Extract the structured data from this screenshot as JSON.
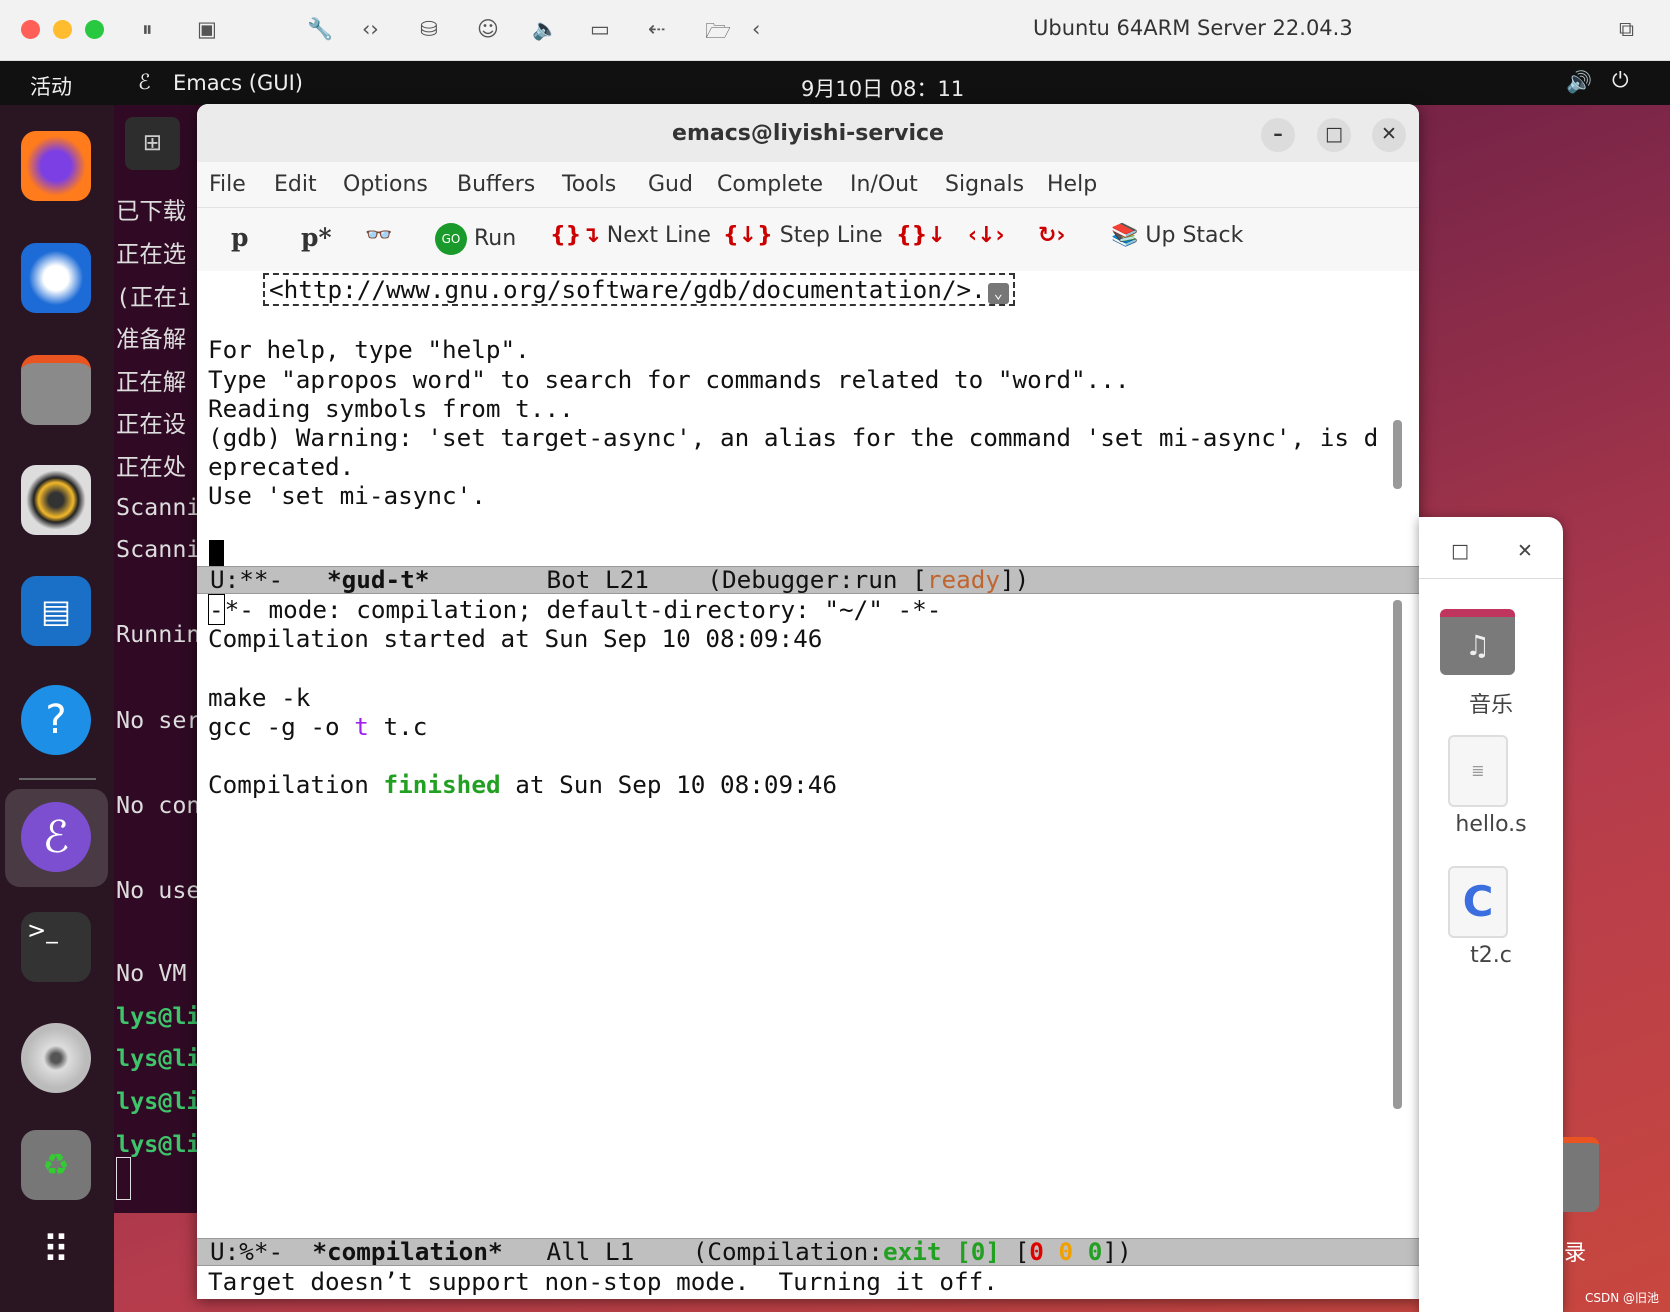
{
  "mac": {
    "title": "Ubuntu 64ARM Server 22.04.3"
  },
  "topbar": {
    "activities": "活动",
    "app": "Emacs (GUI)",
    "clock": "9月10日 08：11"
  },
  "dock": {
    "items": [
      "firefox",
      "thunderbird",
      "files",
      "rhythmbox",
      "writer",
      "help",
      "emacs",
      "terminal",
      "disc",
      "trash",
      "apps-grid"
    ]
  },
  "terminal": {
    "lines": [
      "已下载",
      "正在选",
      "(正在i",
      "准备解",
      "正在解",
      "正在设",
      "正在处",
      "Scanni",
      "Scanni",
      "Runnin",
      "No ser",
      "No con",
      "No use",
      "No VM ",
      "lys@li",
      "lys@li",
      "lys@li",
      "lys@li"
    ]
  },
  "emacs": {
    "title": "emacs@liyishi-service",
    "menu": [
      "File",
      "Edit",
      "Options",
      "Buffers",
      "Tools",
      "Gud",
      "Complete",
      "In/Out",
      "Signals",
      "Help"
    ],
    "toolbar": {
      "p": "p",
      "pstar": "p*",
      "run": "Run",
      "go": "GO",
      "next_line": "Next Line",
      "step_line": "Step Line",
      "up_stack": "Up Stack"
    },
    "gud": {
      "lines": [
        "<http://www.gnu.org/software/gdb/documentation/>.",
        "",
        "For help, type \"help\".",
        "Type \"apropos word\" to search for commands related to \"word\"...",
        "Reading symbols from t...",
        "(gdb) Warning: 'set target-async', an alias for the command 'set mi-async', is d",
        "eprecated.",
        "Use 'set mi-async'."
      ]
    },
    "modeline1": {
      "status": "U:**-",
      "buffer": "*gud-t*",
      "pos": "Bot L21",
      "mode_pre": "(Debugger:run [",
      "state": "ready",
      "mode_post": "])"
    },
    "compilation": {
      "line1": "*- mode: compilation; default-directory: \"~/\" -*-",
      "line2": "Compilation started at Sun Sep 10 08:09:46",
      "make": "make -k",
      "gcc_pre": "gcc -g -o ",
      "gcc_t": "t",
      "gcc_post": " t.c",
      "fin_pre": "Compilation ",
      "fin_word": "finished",
      "fin_post": " at Sun Sep 10 08:09:46"
    },
    "modeline2": {
      "status": "U:%*-",
      "buffer": "*compilation*",
      "pos": "All L1",
      "mode_pre": "(Compilation:",
      "exit": "exit [0]",
      "c1": "0",
      "c2": "0",
      "c3": "0"
    },
    "echo": "Target doesn’t support non-stop mode.  Turning it off."
  },
  "files": {
    "items": [
      "音乐",
      "hello.s",
      "t2.c"
    ],
    "partial_label": "录"
  },
  "watermark": "CSDN @旧池",
  "colors": {
    "ready": "#c0652f",
    "finished": "#22a022",
    "purple": "#a020f0",
    "red": "#e00000",
    "orange": "#f0a000"
  }
}
